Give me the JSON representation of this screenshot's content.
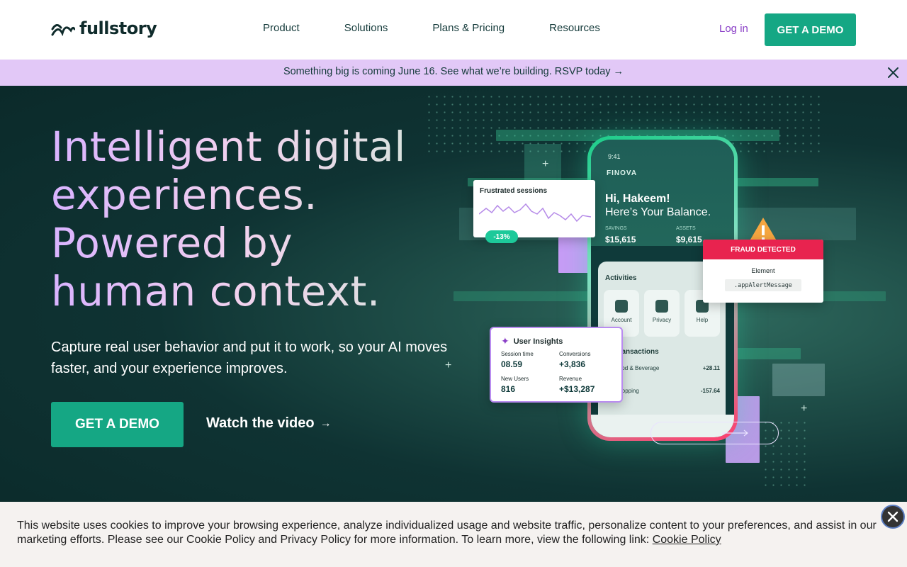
{
  "nav": {
    "logo_text": "fullstory",
    "links": [
      "Product",
      "Solutions",
      "Plans & Pricing",
      "Resources"
    ],
    "login": "Log in",
    "cta": "GET A DEMO"
  },
  "banner": {
    "text": "Something big is coming June 16. See what we’re building. RSVP today →"
  },
  "hero": {
    "headline": [
      "Intelligent digital",
      "experiences.",
      "Powered by",
      "human context."
    ],
    "subhead": "Capture real user behavior and put it to work, so your AI moves faster, and your experience improves.",
    "cta": "GET A DEMO",
    "watch": "Watch the video",
    "watch_arrow": "→"
  },
  "art": {
    "phone": {
      "time": "9:41",
      "brand": "FINOVA",
      "greet_name": "Hi, Hakeem!",
      "greet_sub": "Here’s Your Balance.",
      "savings_label": "SAVINGS",
      "savings_value": "$15,615",
      "assets_label": "ASSETS",
      "assets_value": "$9,615",
      "activities_title": "Activities",
      "activities": [
        "Account",
        "Privacy",
        "Help"
      ],
      "transactions_title": "Transactions",
      "transactions": [
        {
          "name": "Food & Beverage",
          "amount": "+28.11"
        },
        {
          "name": "Shopping",
          "amount": "-157.64"
        }
      ]
    },
    "frustrated": {
      "title": "Frustrated sessions",
      "badge": "-13%"
    },
    "fraud": {
      "title": "FRAUD DETECTED",
      "element_label": "Element",
      "element_code": ".appAlertMessage"
    },
    "insights": {
      "title": "User Insights",
      "session_label": "Session time",
      "session_value": "08.59",
      "conversions_label": "Conversions",
      "conversions_value": "+3,836",
      "users_label": "New Users",
      "users_value": "816",
      "revenue_label": "Revenue",
      "revenue_value": "+$13,287"
    },
    "colors": {
      "accent": "#15a784",
      "purple": "#8a3fc7",
      "fraud": "#e8234f",
      "banner": "#e2c8f7"
    }
  },
  "cookie": {
    "text": "This website uses cookies to improve your browsing experience, analyze individualized usage and website traffic, personalize content to your preferences, and assist in our marketing efforts. Please see our Cookie Policy and Privacy Policy for more information. To learn more, view the following link:",
    "link": "Cookie Policy"
  }
}
